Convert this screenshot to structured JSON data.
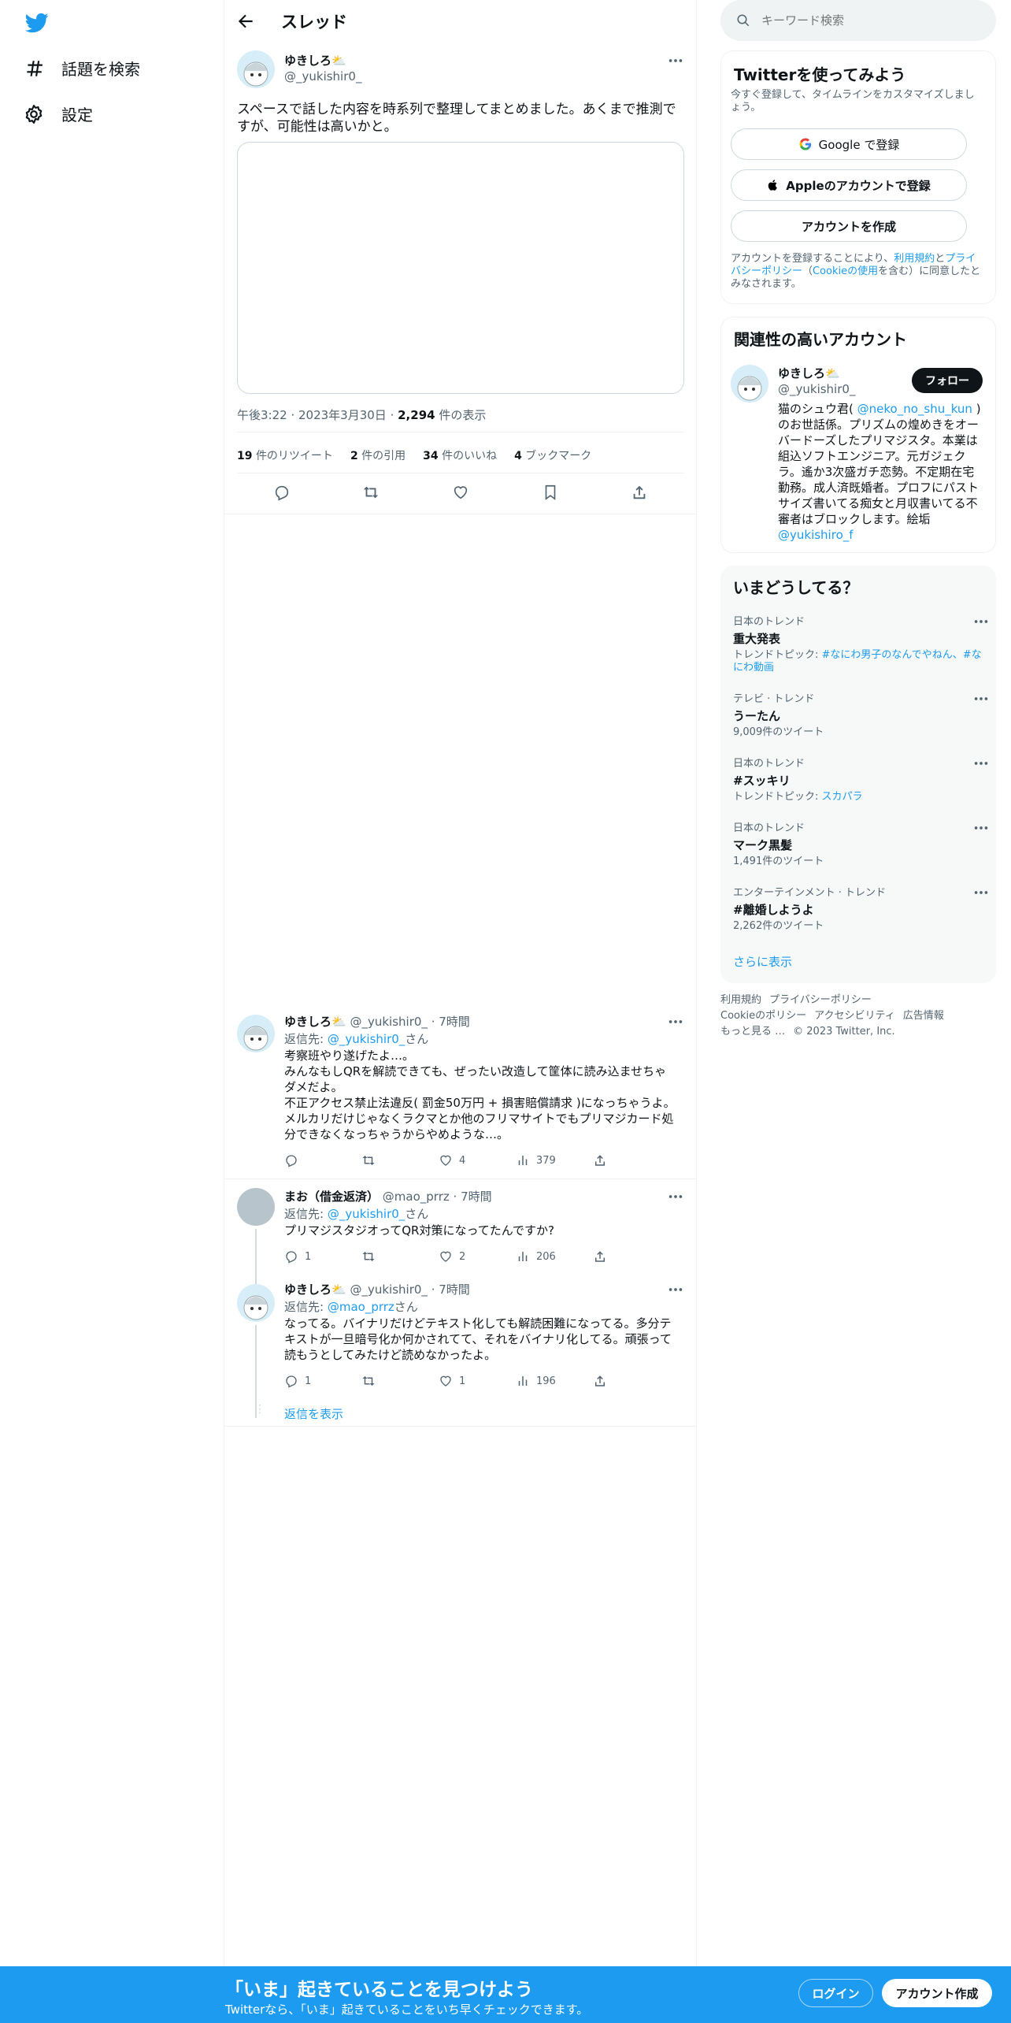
{
  "nav": {
    "explore_label": "話題を検索",
    "settings_label": "設定"
  },
  "header": {
    "title": "スレッド"
  },
  "main_tweet": {
    "name": "ゆきしろ⛅",
    "handle": "@_yukishir0_",
    "text": "スペースで話した内容を時系列で整理してまとめました。あくまで推測ですが、可能性は高いかと。",
    "time": "午後3:22",
    "date": "2023年3月30日",
    "views_count": "2,294",
    "views_label": "件の表示",
    "retweets_count": "19",
    "retweets_label": "件のリツイート",
    "quotes_count": "2",
    "quotes_label": "件の引用",
    "likes_count": "34",
    "likes_label": "件のいいね",
    "bookmarks_count": "4",
    "bookmarks_label": "ブックマーク"
  },
  "replies": [
    {
      "name": "ゆきしろ⛅",
      "handle": "@_yukishir0_",
      "time": "7時間",
      "reply_to_label": "返信先:",
      "reply_to_handle": "@_yukishir0_",
      "reply_to_suffix": "さん",
      "lines": [
        "考察班やり遂げたよ…。",
        "みんなもしQRを解読できても、ぜったい改造して筐体に読み込ませちゃダメだよ。",
        "不正アクセス禁止法違反( 罰金50万円 + 損害賠償請求 )になっちゃうよ。",
        "メルカリだけじゃなくラクマとか他のフリマサイトでもプリマジカード処分できなくなっちゃうからやめような…。"
      ],
      "replies": "",
      "retweets": "",
      "likes": "4",
      "views": "379"
    },
    {
      "name": "まお（借金返済）",
      "handle": "@mao_prrz",
      "time": "7時間",
      "reply_to_label": "返信先:",
      "reply_to_handle": "@_yukishir0_",
      "reply_to_suffix": "さん",
      "lines": [
        "プリマジスタジオってQR対策になってたんですか?"
      ],
      "replies": "1",
      "retweets": "",
      "likes": "2",
      "views": "206"
    },
    {
      "name": "ゆきしろ⛅",
      "handle": "@_yukishir0_",
      "time": "7時間",
      "reply_to_label": "返信先:",
      "reply_to_handle": "@mao_prrz",
      "reply_to_suffix": "さん",
      "lines": [
        "なってる。バイナリだけどテキスト化しても解読困難になってる。多分テキストが一旦暗号化か何かされてて、それをバイナリ化してる。頑張って読もうとしてみたけど読めなかったよ。"
      ],
      "replies": "1",
      "retweets": "",
      "likes": "1",
      "views": "196"
    }
  ],
  "show_replies": "返信を表示",
  "search": {
    "placeholder": "キーワード検索"
  },
  "signup_card": {
    "title": "Twitterを使ってみよう",
    "subtitle": "今すぐ登録して、タイムラインをカスタマイズしましょう。",
    "google": "Google で登録",
    "apple": "Appleのアカウントで登録",
    "create": "アカウントを作成",
    "terms_pre": "アカウントを登録することにより、",
    "terms_link1": "利用規約",
    "terms_mid1": "と",
    "terms_link2": "プライバシーポリシー",
    "terms_mid2": "（",
    "terms_link3": "Cookieの使用",
    "terms_post": "を含む）に同意したとみなされます。"
  },
  "related": {
    "title": "関連性の高いアカウント",
    "name": "ゆきしろ⛅",
    "handle": "@_yukishir0_",
    "follow": "フォロー",
    "bio_pre": "猫のシュウ君( ",
    "bio_link": "@neko_no_shu_kun",
    "bio_post": " )のお世話係。プリズムの煌めきをオーバードーズしたプリマジスタ。本業は組込ソフトエンジニア。元ガジェクラ。遙か3次盛ガチ恋勢。不定期在宅勤務。成人済既婚者。プロフにパストサイズ書いてる痴女と月収書いてる不審者はブロックします。絵垢",
    "bio_link2": "@yukishiro_f"
  },
  "trends": {
    "title": "いまどうしてる？",
    "items": [
      {
        "category": "日本のトレンド",
        "name": "重大発表",
        "sub_label": "トレンドトピック:",
        "sub_link": "#なにわ男子のなんでやねん、#なにわ動画",
        "count": ""
      },
      {
        "category": "テレビ · トレンド",
        "name": "うーたん",
        "sub_label": "",
        "sub_link": "",
        "count": "9,009件のツイート"
      },
      {
        "category": "日本のトレンド",
        "name": "#スッキリ",
        "sub_label": "トレンドトピック:",
        "sub_link": "スカパラ",
        "count": ""
      },
      {
        "category": "日本のトレンド",
        "name": "マーク黒髪",
        "sub_label": "",
        "sub_link": "",
        "count": "1,491件のツイート"
      },
      {
        "category": "エンターテインメント · トレンド",
        "name": "#離婚しようよ",
        "sub_label": "",
        "sub_link": "",
        "count": "2,262件のツイート"
      }
    ],
    "show_more": "さらに表示"
  },
  "footer": {
    "links": [
      "利用規約",
      "プライバシーポリシー",
      "Cookieのポリシー",
      "アクセシビリティ",
      "広告情報",
      "もっと見る …"
    ],
    "copyright": "© 2023 Twitter, Inc."
  },
  "bottom_bar": {
    "title": "「いま」起きていることを見つけよう",
    "subtitle": "Twitterなら、「いま」起きていることをいち早くチェックできます。",
    "login": "ログイン",
    "signup": "アカウント作成"
  },
  "colors": {
    "accent": "#1d9bf0",
    "text": "#0f1419",
    "muted": "#536471"
  }
}
